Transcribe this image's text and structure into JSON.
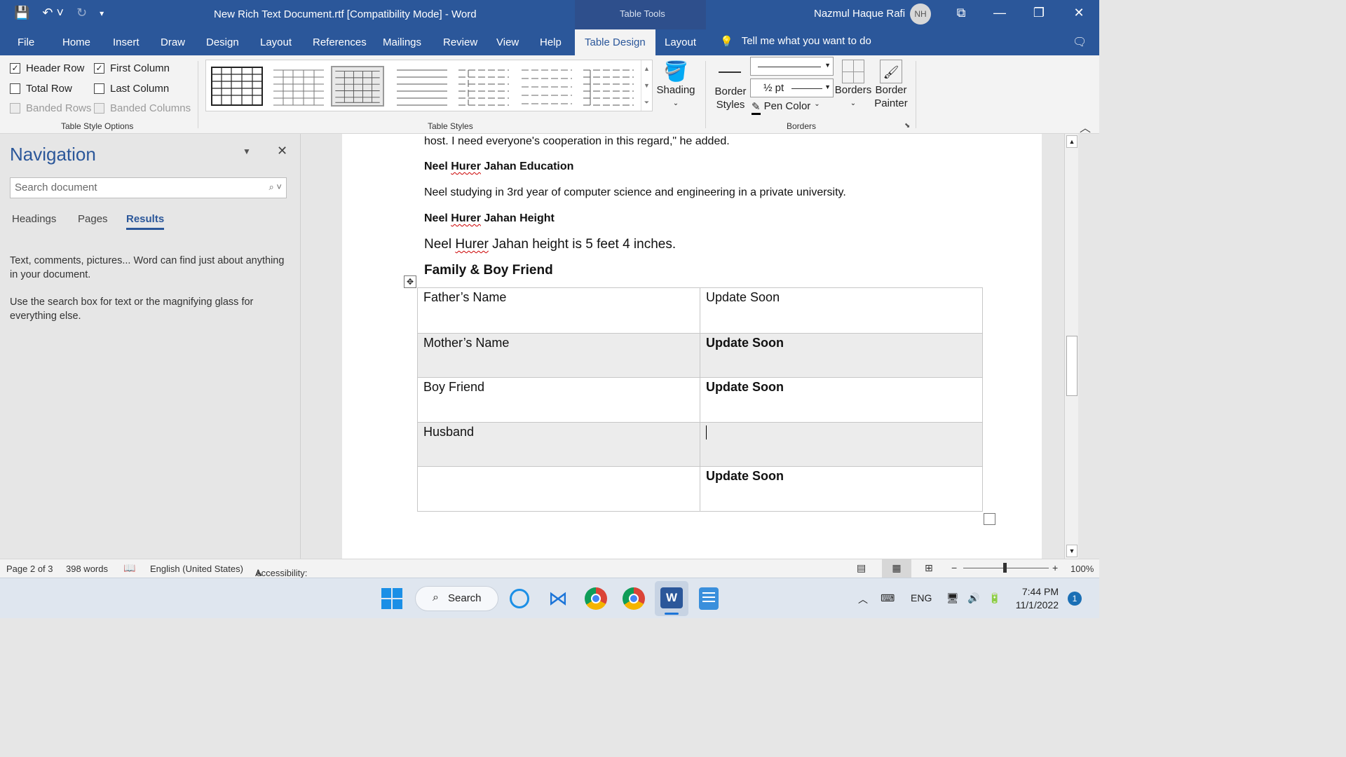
{
  "titlebar": {
    "document_title": "New Rich Text Document.rtf [Compatibility Mode]  -  Word",
    "context_label": "Table Tools",
    "user_name": "Nazmul Haque Rafi",
    "user_initials": "NH"
  },
  "tabs": [
    "File",
    "Home",
    "Insert",
    "Draw",
    "Design",
    "Layout",
    "References",
    "Mailings",
    "Review",
    "View",
    "Help",
    "Table Design",
    "Layout"
  ],
  "active_tab": "Table Design",
  "tell_me": "Tell me what you want to do",
  "ribbon": {
    "table_style_options": {
      "label": "Table Style Options",
      "header_row": "Header Row",
      "first_column": "First Column",
      "total_row": "Total Row",
      "last_column": "Last Column",
      "banded_rows": "Banded Rows",
      "banded_columns": "Banded Columns"
    },
    "table_styles_label": "Table Styles",
    "shading": "Shading",
    "borders_group": {
      "label": "Borders",
      "border_styles": [
        "Border",
        "Styles"
      ],
      "pen_weight": "½ pt",
      "pen_color": "Pen Color",
      "borders": "Borders",
      "border_painter": [
        "Border",
        "Painter"
      ]
    }
  },
  "navigation": {
    "title": "Navigation",
    "search_placeholder": "Search document",
    "tabs": [
      "Headings",
      "Pages",
      "Results"
    ],
    "active_tab": "Results",
    "help1": "Text, comments, pictures... Word can find just about anything in your document.",
    "help2": "Use the search box for text or the magnifying glass for everything else."
  },
  "document": {
    "line1": "host. I need everyone's cooperation in this regard,\" he added.",
    "edu_heading": [
      "Neel ",
      "Hurer",
      " Jahan Education"
    ],
    "edu_text": "Neel studying in 3rd year of computer science and engineering in a private university.",
    "height_heading": [
      "Neel ",
      "Hurer",
      " Jahan Height"
    ],
    "height_text": [
      "Neel ",
      "Hurer",
      " Jahan height is 5 feet 4 inches."
    ],
    "family_heading": "Family & Boy Friend",
    "table": [
      [
        "Father’s Name",
        "Update Soon"
      ],
      [
        "Mother’s Name",
        "Update Soon"
      ],
      [
        "Boy Friend",
        "Update Soon"
      ],
      [
        "Husband",
        ""
      ],
      [
        "",
        "Update Soon"
      ]
    ]
  },
  "status": {
    "page": "Page 2 of 3",
    "words": "398 words",
    "language": "English (United States)",
    "accessibility": "Accessibility: Unavailable",
    "zoom": "100%"
  },
  "taskbar": {
    "search": "Search",
    "lang": "ENG",
    "time": "7:44 PM",
    "date": "11/1/2022",
    "notifications": "1"
  }
}
